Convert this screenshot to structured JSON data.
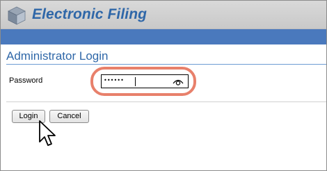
{
  "app": {
    "title": "Electronic Filing",
    "icon": "cube-logo-icon"
  },
  "page": {
    "title": "Administrator Login"
  },
  "form": {
    "password_label": "Password",
    "password_value": "••••••",
    "reveal_icon": "eye-icon"
  },
  "buttons": {
    "login_label": "Login",
    "cancel_label": "Cancel"
  },
  "colors": {
    "accent": "#4a79bd",
    "title_text": "#2f67a8",
    "highlight": "#e8806b"
  }
}
